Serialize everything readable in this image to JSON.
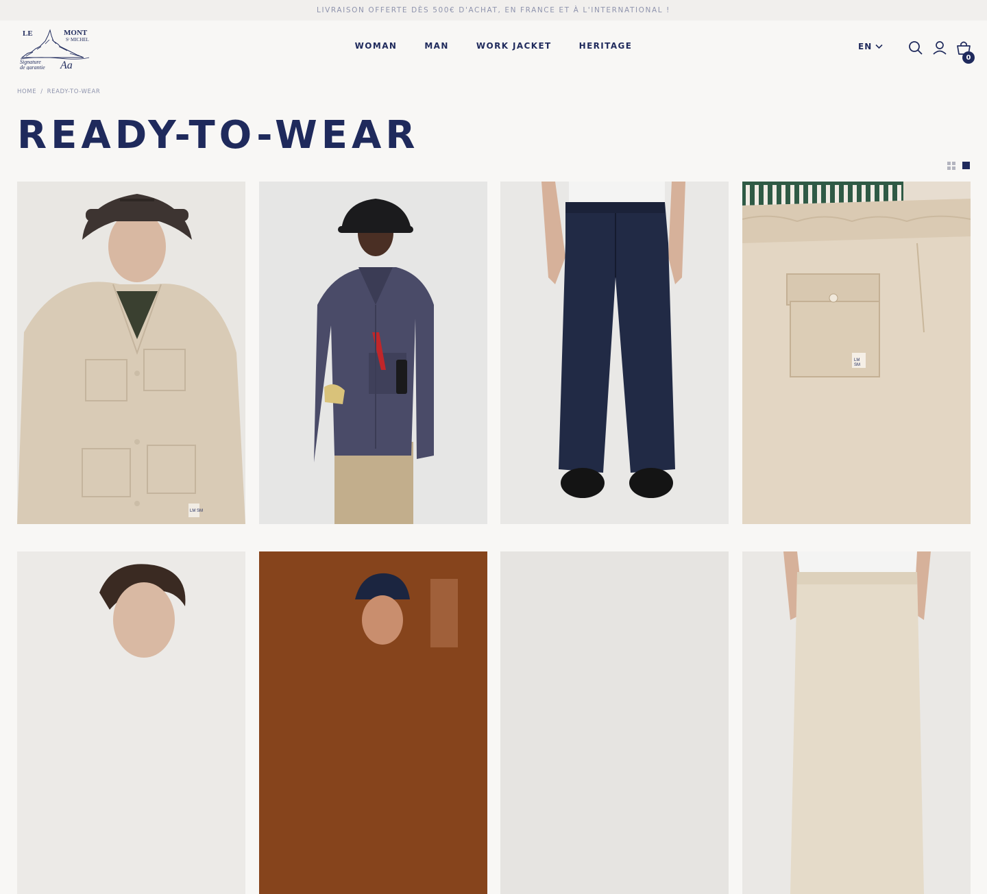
{
  "announcement": "LIVRAISON OFFERTE DÈS 500€ D'ACHAT, EN FRANCE ET À L'INTERNATIONAL !",
  "logo": {
    "line1": "LE",
    "line2": "MONT",
    "line3": "Sᵗ MICHEL",
    "signature": "Signature de garantie",
    "initials": "Aa"
  },
  "nav": {
    "items": [
      {
        "label": "WOMAN"
      },
      {
        "label": "MAN"
      },
      {
        "label": "WORK JACKET"
      },
      {
        "label": "HERITAGE"
      }
    ]
  },
  "header": {
    "language": "EN",
    "cart_count": "0"
  },
  "breadcrumb": {
    "home": "HOME",
    "separator": "/",
    "current": "READY-TO-WEAR"
  },
  "page_title": "READY-TO-WEAR",
  "patch_label": "LM SM",
  "colors": {
    "brand_navy": "#1f2a5c",
    "background": "#f8f7f5",
    "muted": "#8e93ad"
  },
  "icons": [
    "search-icon",
    "account-icon",
    "cart-icon",
    "chevron-down-icon",
    "grid-small-icon",
    "grid-large-icon"
  ]
}
